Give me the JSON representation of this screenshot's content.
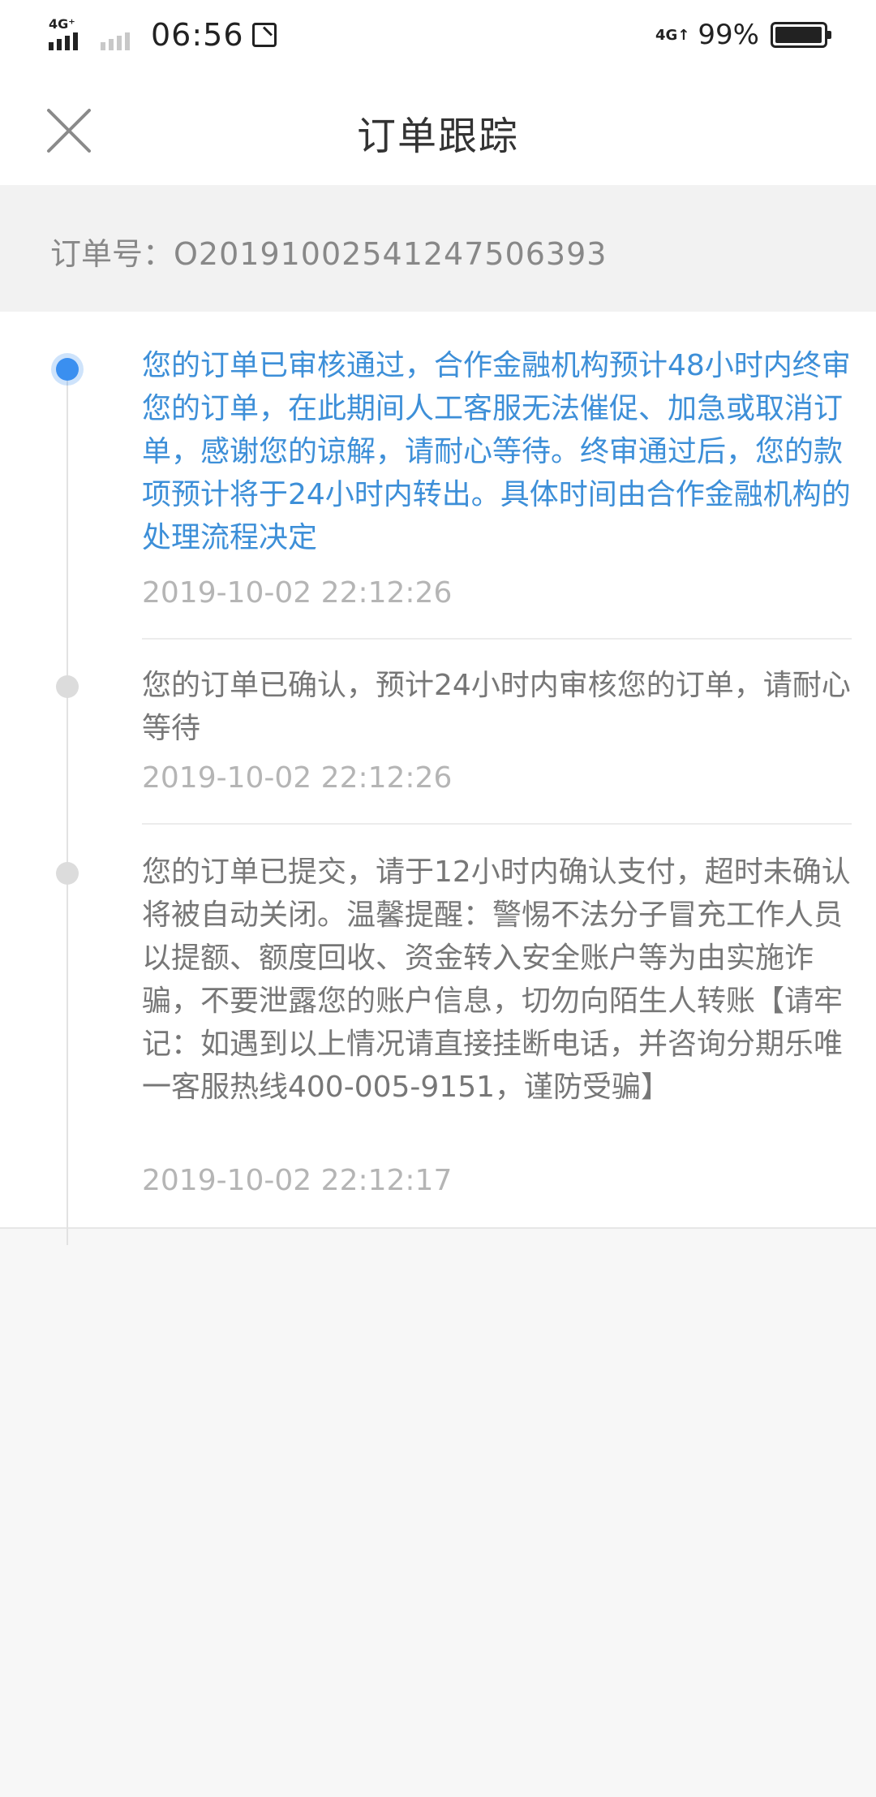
{
  "status_bar": {
    "network_tag_1": "4G⁺",
    "time": "06:56",
    "network_tag_2": "4G↑",
    "battery_percent": "99%",
    "battery_level": 0.99
  },
  "nav": {
    "title": "订单跟踪",
    "close_icon": "close-icon"
  },
  "order": {
    "label": "订单号：",
    "number": "O20191002541247506393"
  },
  "timeline": {
    "entries": [
      {
        "text": "您的订单已审核通过，合作金融机构预计48小时内终审您的订单，在此期间人工客服无法催促、加急或取消订单，感谢您的谅解，请耐心等待。终审通过后，您的款项预计将于24小时内转出。具体时间由合作金融机构的处理流程决定",
        "time": "2019-10-02 22:12:26",
        "active": true
      },
      {
        "text": "您的订单已确认，预计24小时内审核您的订单，请耐心等待",
        "time": "2019-10-02 22:12:26",
        "active": false
      },
      {
        "text": "您的订单已提交，请于12小时内确认支付，超时未确认将被自动关闭。温馨提醒：警惕不法分子冒充工作人员以提额、额度回收、资金转入安全账户等为由实施诈骗，不要泄露您的账户信息，切勿向陌生人转账【请牢记：如遇到以上情况请直接挂断电话，并咨询分期乐唯一客服热线400-005-9151，谨防受骗】",
        "time": "2019-10-02 22:12:17",
        "active": false
      }
    ]
  },
  "colors": {
    "accent": "#3a8ff0",
    "active_text": "#3d8fd8",
    "inactive_text": "#777777",
    "timestamp": "#b5b5b5"
  }
}
